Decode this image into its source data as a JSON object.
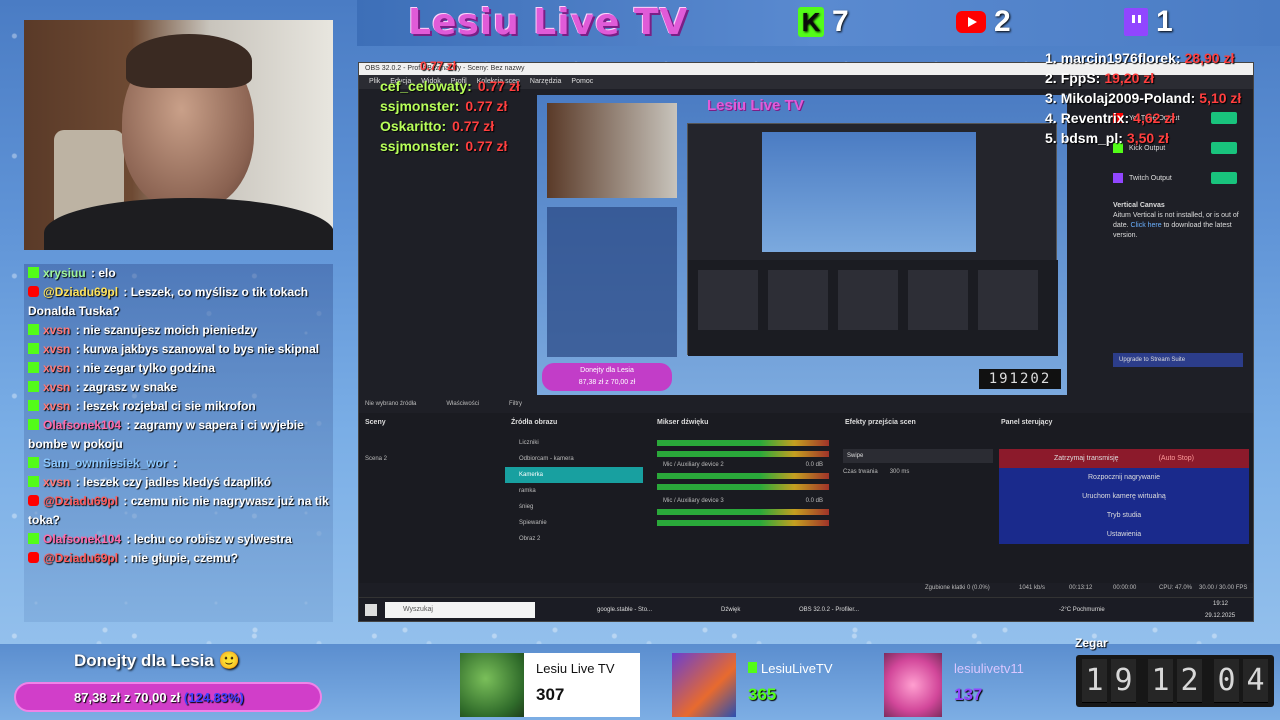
{
  "header": {
    "title": "Lesiu Live TV",
    "counters": [
      {
        "platform": "kick",
        "icon": "kick-logo-icon",
        "value": "7"
      },
      {
        "platform": "youtube",
        "icon": "youtube-logo-icon",
        "value": "2"
      },
      {
        "platform": "twitch",
        "icon": "twitch-logo-icon",
        "value": "1"
      }
    ]
  },
  "colors": {
    "kick": "#53fc18",
    "youtube": "#ff0000",
    "twitch": "#9146ff",
    "donation_bar": "#d13ec9",
    "brand": "#e05bd8"
  },
  "chat": [
    {
      "platform": "kick",
      "user": "xrysiuu",
      "text": "elo",
      "color": "green"
    },
    {
      "platform": "youtube",
      "user": "@Dziadu69pl",
      "text": "Leszek, co myślisz o tik tokach Donalda Tuska?",
      "color": "yellow"
    },
    {
      "platform": "kick",
      "user": "xvsn",
      "text": "nie szanujesz moich pieniedzy",
      "color": "orange"
    },
    {
      "platform": "kick",
      "user": "xvsn",
      "text": "kurwa jakbys szanowal to bys nie skipnal",
      "color": "orange"
    },
    {
      "platform": "kick",
      "user": "xvsn",
      "text": "nie zegar tylko godzina",
      "color": "orange"
    },
    {
      "platform": "kick",
      "user": "xvsn",
      "text": "zagrasz w snake",
      "color": "orange"
    },
    {
      "platform": "kick",
      "user": "xvsn",
      "text": "leszek rozjebal ci sie mikrofon",
      "color": "orange"
    },
    {
      "platform": "kick",
      "user": "Olafsonek104",
      "text": "zagramy w sapera i ci wyjebie bombe w pokoju",
      "color": "pink"
    },
    {
      "platform": "kick",
      "user": "Sam_ownniesiek_wor",
      "text": "",
      "color": "blue"
    },
    {
      "platform": "kick",
      "user": "xvsn",
      "text": "leszek czy jadles kledyś dzaplikó",
      "color": "orange"
    },
    {
      "platform": "youtube",
      "user": "@Dziadu69pl",
      "text": "czemu nic nie nagrywasz już na tik toka?",
      "color": "red"
    },
    {
      "platform": "kick",
      "user": "Olafsonek104",
      "text": "lechu co robisz w sylwestra",
      "color": "pink"
    },
    {
      "platform": "youtube",
      "user": "@Dziadu69pl",
      "text": "nie głupie, czemu?",
      "color": "red"
    }
  ],
  "tips_overlay": [
    {
      "name": "cef_celowaty:",
      "amount": "0.77 zł"
    },
    {
      "name": "ssjmonster:",
      "amount": "0.77 zł"
    },
    {
      "name": "Oskaritto:",
      "amount": "0.77 zł"
    },
    {
      "name": "ssjmonster:",
      "amount": "0.77 zł"
    }
  ],
  "tips_top_amount": "0.77 zł",
  "ranking": [
    {
      "rank": "1.",
      "name": "marcin1976florek:",
      "amount": "28,90 zł"
    },
    {
      "rank": "2.",
      "name": "FppS:",
      "amount": "19,20 zł"
    },
    {
      "rank": "3.",
      "name": "Mikolaj2009-Poland:",
      "amount": "5,10 zł"
    },
    {
      "rank": "4.",
      "name": "Reventrix:",
      "amount": "4,62 zł"
    },
    {
      "rank": "5.",
      "name": "bdsm_pl:",
      "amount": "3,50 zł"
    }
  ],
  "obs": {
    "window_title": "OBS 32.0.2 - Profil: Bez nazwy - Sceny: Bez nazwy",
    "menu": [
      "Plik",
      "Edycja",
      "Widok",
      "Profil",
      "Kolekcja scen",
      "Narzędzia",
      "Pomoc"
    ],
    "preview": {
      "brand": "Lesiu Live TV",
      "donation": "Donejty dla Lesia",
      "donation_amount": "87,38 zł z 70,00 zł",
      "clock": "191202"
    },
    "outputs": [
      {
        "label": "YouTube Output",
        "icon": "youtube-logo-icon"
      },
      {
        "label": "Kick Output",
        "icon": "kick-logo-icon"
      },
      {
        "label": "Twitch Output",
        "icon": "twitch-logo-icon"
      }
    ],
    "vertical_canvas": {
      "title": "Vertical Canvas",
      "text": "Aitum Vertical is not installed, or is out of date.",
      "link": "Click here",
      "link_rest": " to download the latest version."
    },
    "upgrade": "Upgrade to Stream Suite",
    "no_source": "Nie wybrano źródła",
    "props": "Właściwości",
    "filters": "Filtry",
    "docks": {
      "scenes": "Sceny",
      "sources": "Źródła obrazu",
      "mixer": "Mikser dźwięku",
      "transitions": "Efekty przejścia scen",
      "controls": "Panel sterujący"
    },
    "scenes": [
      "Scena 2"
    ],
    "sources": [
      "Liczniki",
      "Odbiorcam - kamera",
      "Kamerka",
      "ramka",
      "śnieg",
      "Spiewanie",
      "Obraz 2"
    ],
    "mixer_tracks": [
      "Mic / Auxiliary device 2",
      "Mic / Auxiliary device 3"
    ],
    "mixer_db": [
      "0.0 dB",
      "0.0 dB"
    ],
    "transition": "Swipe",
    "duration_label": "Czas trwania",
    "duration": "300 ms",
    "controls": [
      {
        "label": "Zatrzymaj transmisję",
        "extra": "(Auto Stop)",
        "style": "red"
      },
      {
        "label": "Rozpocznij nagrywanie",
        "extra": "",
        "style": "blue"
      },
      {
        "label": "Uruchom kamerę wirtualną",
        "extra": "",
        "style": "blue"
      },
      {
        "label": "Tryb studia",
        "extra": "",
        "style": "blue"
      },
      {
        "label": "Ustawienia",
        "extra": "",
        "style": "blue"
      }
    ],
    "status": {
      "dropped": "Zgubione klatki 0 (0.0%)",
      "bitrate": "1041 kb/s",
      "live": "00:13:12",
      "rec": "00:00:00",
      "cpu": "CPU: 47.0%",
      "fps": "30.00 / 30.00 FPS"
    },
    "taskbar": {
      "search": "Wyszukaj",
      "apps": [
        "google.stable - Sto...",
        "Dźwięk",
        "OBS 32.0.2 - Profiler..."
      ],
      "weather": "-2°C Pochmurnie",
      "time": "19:12",
      "date": "29.12.2025"
    }
  },
  "donations": {
    "title": "Donejty dla Lesia",
    "emoji": "🙂",
    "amount": "87,38 zł",
    "separator": "z",
    "goal": "70,00 zł",
    "overflow": "(124.83%)",
    "progress": 1.2483
  },
  "cards": [
    {
      "title": "Lesiu Live TV",
      "value": "307",
      "icon": "photo-thumbnail"
    },
    {
      "title": "LesiuLiveTV",
      "value": "365",
      "icon": "kick-logo-icon"
    },
    {
      "title": "lesiulivetv11",
      "value": "137",
      "icon": "twitch-logo-icon"
    }
  ],
  "clock": {
    "label": "Zegar",
    "digits": [
      "1",
      "9",
      "1",
      "2",
      "0",
      "4"
    ]
  }
}
